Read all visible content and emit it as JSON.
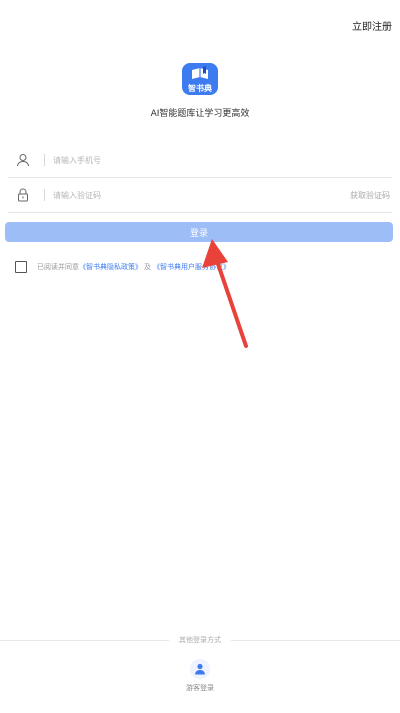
{
  "header": {
    "register_label": "立即注册"
  },
  "brand": {
    "logo_text": "智书典",
    "slogan": "AI智能题库让学习更高效",
    "accent_color": "#3d7bf0"
  },
  "form": {
    "phone_placeholder": "请输入手机号",
    "code_placeholder": "请输入验证码",
    "get_code_label": "获取验证码",
    "login_label": "登录",
    "login_button_color": "#9dbdf6"
  },
  "agreement": {
    "prefix": "已阅读并同意",
    "privacy_link": "《智书典隐私政策》",
    "conjunction": "及",
    "terms_link": "《智书典用户服务协议》"
  },
  "footer": {
    "other_login_label": "其他登录方式",
    "visitor_label": "游客登录"
  },
  "icons": {
    "phone_field": "user-icon",
    "code_field": "lock-icon",
    "visitor": "person-icon",
    "annotation": "red-arrow"
  }
}
